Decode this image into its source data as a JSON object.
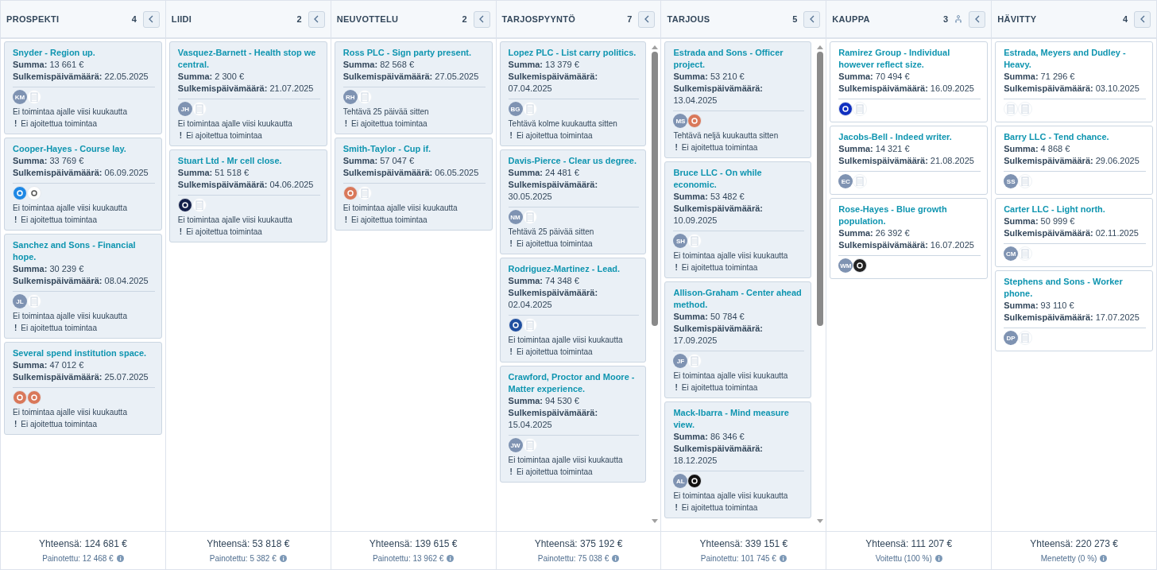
{
  "columns": [
    {
      "title": "PROSPEKTI",
      "count": "4",
      "kind": "open",
      "scrollable": false,
      "total": "Yhteensä: 124 681 €",
      "subtotal": "Painotettu: 12 468 €",
      "cards": [
        {
          "title": "Snyder - Region up.",
          "amount_label": "Summa:",
          "amount": "13 661 €",
          "date_label": "Sulkemispäivämäärä:",
          "date": "22.05.2025",
          "avatars": [
            {
              "kind": "initials",
              "text": "KM"
            },
            {
              "kind": "company"
            }
          ],
          "activity": "Ei toimintaa ajalle viisi kuukautta",
          "schedule_mark": "!",
          "schedule": "Ei ajoitettua toimintaa"
        },
        {
          "title": "Cooper-Hayes - Course lay.",
          "amount_label": "Summa:",
          "amount": "33 769 €",
          "date_label": "Sulkemispäivämäärä:",
          "date": "06.09.2025",
          "avatars": [
            {
              "kind": "logo",
              "color": "#1e88e5"
            },
            {
              "kind": "logo",
              "color": "#ffffff"
            }
          ],
          "activity": "Ei toimintaa ajalle viisi kuukautta",
          "schedule_mark": "!",
          "schedule": "Ei ajoitettua toimintaa"
        },
        {
          "title": "Sanchez and Sons - Financial hope.",
          "amount_label": "Summa:",
          "amount": "30 239 €",
          "date_label": "Sulkemispäivämäärä:",
          "date": "08.04.2025",
          "avatars": [
            {
              "kind": "initials",
              "text": "JL"
            },
            {
              "kind": "company"
            }
          ],
          "activity": "Ei toimintaa ajalle viisi kuukautta",
          "schedule_mark": "!",
          "schedule": "Ei ajoitettua toimintaa"
        },
        {
          "title": "Several spend institution space.",
          "amount_label": "Summa:",
          "amount": "47 012 €",
          "date_label": "Sulkemispäivämäärä:",
          "date": "25.07.2025",
          "avatars": [
            {
              "kind": "logo",
              "color": "#d9785a"
            },
            {
              "kind": "logo",
              "color": "#d9785a"
            }
          ],
          "activity": "Ei toimintaa ajalle viisi kuukautta",
          "schedule_mark": "!",
          "schedule": "Ei ajoitettua toimintaa"
        }
      ]
    },
    {
      "title": "LIIDI",
      "count": "2",
      "kind": "open",
      "scrollable": false,
      "total": "Yhteensä: 53 818 €",
      "subtotal": "Painotettu: 5 382 €",
      "cards": [
        {
          "title": "Vasquez-Barnett - Health stop we central.",
          "amount_label": "Summa:",
          "amount": "2 300 €",
          "date_label": "Sulkemispäivämäärä:",
          "date": "21.07.2025",
          "avatars": [
            {
              "kind": "initials",
              "text": "JH"
            },
            {
              "kind": "company"
            }
          ],
          "activity": "Ei toimintaa ajalle viisi kuukautta",
          "schedule_mark": "!",
          "schedule": "Ei ajoitettua toimintaa"
        },
        {
          "title": "Stuart Ltd - Mr cell close.",
          "amount_label": "Summa:",
          "amount": "51 518 €",
          "date_label": "Sulkemispäivämäärä:",
          "date": "04.06.2025",
          "avatars": [
            {
              "kind": "logo",
              "color": "#14204a"
            },
            {
              "kind": "company"
            }
          ],
          "activity": "Ei toimintaa ajalle viisi kuukautta",
          "schedule_mark": "!",
          "schedule": "Ei ajoitettua toimintaa"
        }
      ]
    },
    {
      "title": "NEUVOTTELU",
      "count": "2",
      "kind": "open",
      "scrollable": false,
      "total": "Yhteensä: 139 615 €",
      "subtotal": "Painotettu: 13 962 €",
      "cards": [
        {
          "title": "Ross PLC - Sign party present.",
          "amount_label": "Summa:",
          "amount": "82 568 €",
          "date_label": "Sulkemispäivämäärä:",
          "date": "27.05.2025",
          "avatars": [
            {
              "kind": "initials",
              "text": "RH"
            },
            {
              "kind": "company"
            }
          ],
          "activity": "Tehtävä 25 päivää sitten",
          "schedule_mark": "!",
          "schedule": "Ei ajoitettua toimintaa"
        },
        {
          "title": "Smith-Taylor - Cup if.",
          "amount_label": "Summa:",
          "amount": "57 047 €",
          "date_label": "Sulkemispäivämäärä:",
          "date": "06.05.2025",
          "avatars": [
            {
              "kind": "logo",
              "color": "#d9785a"
            },
            {
              "kind": "company"
            }
          ],
          "activity": "Ei toimintaa ajalle viisi kuukautta",
          "schedule_mark": "!",
          "schedule": "Ei ajoitettua toimintaa"
        }
      ]
    },
    {
      "title": "TARJOSPYYNTÖ",
      "count": "7",
      "kind": "open",
      "scrollable": true,
      "total": "Yhteensä: 375 192 €",
      "subtotal": "Painotettu: 75 038 €",
      "cards": [
        {
          "title": "Lopez PLC - List carry politics.",
          "amount_label": "Summa:",
          "amount": "13 379 €",
          "date_label": "Sulkemispäivämäärä:",
          "date": "07.04.2025",
          "avatars": [
            {
              "kind": "initials",
              "text": "BG"
            },
            {
              "kind": "company"
            }
          ],
          "activity": "Tehtävä kolme kuukautta sitten",
          "schedule_mark": "!",
          "schedule": "Ei ajoitettua toimintaa"
        },
        {
          "title": "Davis-Pierce - Clear us degree.",
          "amount_label": "Summa:",
          "amount": "24 481 €",
          "date_label": "Sulkemispäivämäärä:",
          "date": "30.05.2025",
          "avatars": [
            {
              "kind": "initials",
              "text": "NM"
            },
            {
              "kind": "company"
            }
          ],
          "activity": "Tehtävä 25 päivää sitten",
          "schedule_mark": "!",
          "schedule": "Ei ajoitettua toimintaa"
        },
        {
          "title": "Rodriguez-Martinez - Lead.",
          "amount_label": "Summa:",
          "amount": "74 348 €",
          "date_label": "Sulkemispäivämäärä:",
          "date": "02.04.2025",
          "avatars": [
            {
              "kind": "logo",
              "color": "#1f4fa0"
            },
            {
              "kind": "company"
            }
          ],
          "activity": "Ei toimintaa ajalle viisi kuukautta",
          "schedule_mark": "!",
          "schedule": "Ei ajoitettua toimintaa"
        },
        {
          "title": "Crawford, Proctor and Moore - Matter experience.",
          "amount_label": "Summa:",
          "amount": "94 530 €",
          "date_label": "Sulkemispäivämäärä:",
          "date": "15.04.2025",
          "avatars": [
            {
              "kind": "initials",
              "text": "JW"
            },
            {
              "kind": "company"
            }
          ],
          "activity": "Ei toimintaa ajalle viisi kuukautta",
          "schedule_mark": "!",
          "schedule": "Ei ajoitettua toimintaa"
        }
      ]
    },
    {
      "title": "TARJOUS",
      "count": "5",
      "kind": "open",
      "scrollable": true,
      "total": "Yhteensä: 339 151 €",
      "subtotal": "Painotettu: 101 745 €",
      "cards": [
        {
          "title": "Estrada and Sons - Officer project.",
          "amount_label": "Summa:",
          "amount": "53 210 €",
          "date_label": "Sulkemispäivämäärä:",
          "date": "13.04.2025",
          "avatars": [
            {
              "kind": "initials",
              "text": "MS"
            },
            {
              "kind": "logo",
              "color": "#d9785a"
            }
          ],
          "activity": "Tehtävä neljä kuukautta sitten",
          "schedule_mark": "!",
          "schedule": "Ei ajoitettua toimintaa"
        },
        {
          "title": "Bruce LLC - On while economic.",
          "amount_label": "Summa:",
          "amount": "53 482 €",
          "date_label": "Sulkemispäivämäärä:",
          "date": "10.09.2025",
          "avatars": [
            {
              "kind": "initials",
              "text": "SH"
            },
            {
              "kind": "company"
            }
          ],
          "activity": "Ei toimintaa ajalle viisi kuukautta",
          "schedule_mark": "!",
          "schedule": "Ei ajoitettua toimintaa"
        },
        {
          "title": "Allison-Graham - Center ahead method.",
          "amount_label": "Summa:",
          "amount": "50 784 €",
          "date_label": "Sulkemispäivämäärä:",
          "date": "17.09.2025",
          "avatars": [
            {
              "kind": "initials",
              "text": "JF"
            },
            {
              "kind": "company"
            }
          ],
          "activity": "Ei toimintaa ajalle viisi kuukautta",
          "schedule_mark": "!",
          "schedule": "Ei ajoitettua toimintaa"
        },
        {
          "title": "Mack-Ibarra - Mind measure view.",
          "amount_label": "Summa:",
          "amount": "86 346 €",
          "date_label": "Sulkemispäivämäärä:",
          "date": "18.12.2025",
          "avatars": [
            {
              "kind": "initials",
              "text": "AL"
            },
            {
              "kind": "logo",
              "color": "#111111"
            }
          ],
          "activity": "Ei toimintaa ajalle viisi kuukautta",
          "schedule_mark": "!",
          "schedule": "Ei ajoitettua toimintaa"
        }
      ]
    },
    {
      "title": "KAUPPA",
      "count": "3",
      "kind": "won",
      "scrollable": false,
      "total": "Yhteensä: 111 207 €",
      "subtotal": "Voitettu (100 %)",
      "cards": [
        {
          "title": "Ramirez Group - Individual however reflect size.",
          "amount_label": "Summa:",
          "amount": "70 494 €",
          "date_label": "Sulkemispäivämäärä:",
          "date": "16.09.2025",
          "avatars": [
            {
              "kind": "logo",
              "color": "#1030c0"
            },
            {
              "kind": "company"
            }
          ]
        },
        {
          "title": "Jacobs-Bell - Indeed writer.",
          "amount_label": "Summa:",
          "amount": "14 321 €",
          "date_label": "Sulkemispäivämäärä:",
          "date": "21.08.2025",
          "avatars": [
            {
              "kind": "initials",
              "text": "EC"
            },
            {
              "kind": "company"
            }
          ]
        },
        {
          "title": "Rose-Hayes - Blue growth population.",
          "amount_label": "Summa:",
          "amount": "26 392 €",
          "date_label": "Sulkemispäivämäärä:",
          "date": "16.07.2025",
          "avatars": [
            {
              "kind": "initials",
              "text": "WM"
            },
            {
              "kind": "logo",
              "color": "#222222"
            }
          ]
        }
      ]
    },
    {
      "title": "HÄVITTY",
      "count": "4",
      "kind": "lost",
      "scrollable": false,
      "total": "Yhteensä: 220 273 €",
      "subtotal": "Menetetty (0 %)",
      "cards": [
        {
          "title": "Estrada, Meyers and Dudley - Heavy.",
          "amount_label": "Summa:",
          "amount": "71 296 €",
          "date_label": "Sulkemispäivämäärä:",
          "date": "03.10.2025",
          "avatars": [
            {
              "kind": "company"
            },
            {
              "kind": "company"
            }
          ]
        },
        {
          "title": "Barry LLC - Tend chance.",
          "amount_label": "Summa:",
          "amount": "4 868 €",
          "date_label": "Sulkemispäivämäärä:",
          "date": "29.06.2025",
          "avatars": [
            {
              "kind": "initials",
              "text": "SS"
            },
            {
              "kind": "company"
            }
          ]
        },
        {
          "title": "Carter LLC - Light north.",
          "amount_label": "Summa:",
          "amount": "50 999 €",
          "date_label": "Sulkemispäivämäärä:",
          "date": "02.11.2025",
          "avatars": [
            {
              "kind": "initials",
              "text": "CM"
            },
            {
              "kind": "company"
            }
          ]
        },
        {
          "title": "Stephens and Sons - Worker phone.",
          "amount_label": "Summa:",
          "amount": "93 110 €",
          "date_label": "Sulkemispäivämäärä:",
          "date": "17.07.2025",
          "avatars": [
            {
              "kind": "initials",
              "text": "DP"
            },
            {
              "kind": "company"
            }
          ]
        }
      ]
    }
  ]
}
